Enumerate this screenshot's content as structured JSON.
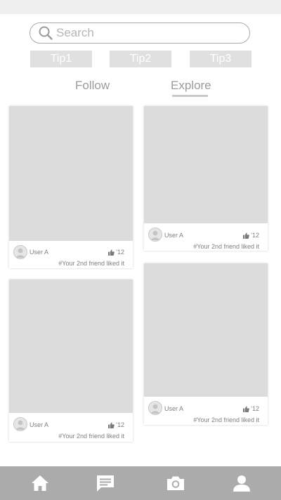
{
  "search": {
    "placeholder": "Search"
  },
  "tips": [
    "Tip1",
    "Tip2",
    "Tip3"
  ],
  "tabs": {
    "follow": "Follow",
    "explore": "Explore",
    "active": "Explore"
  },
  "posts": [
    {
      "user": "User A",
      "likes": "12",
      "note": "#Your 2nd friend liked it"
    },
    {
      "user": "User A",
      "likes": "12",
      "note": "#Your 2nd friend liked it"
    },
    {
      "user": "User A",
      "likes": "12",
      "note": "#Your 2nd friend liked it"
    },
    {
      "user": "User A",
      "likes": "12",
      "note": "#Your 2nd friend liked it"
    }
  ],
  "bottom_nav": {
    "icons": [
      "home-icon",
      "chat-icon",
      "camera-icon",
      "profile-icon"
    ]
  },
  "colors": {
    "placeholder_gray": "#dcdcdc",
    "nav_bar": "#ababab",
    "tab_underline": "#c9c9c9"
  }
}
